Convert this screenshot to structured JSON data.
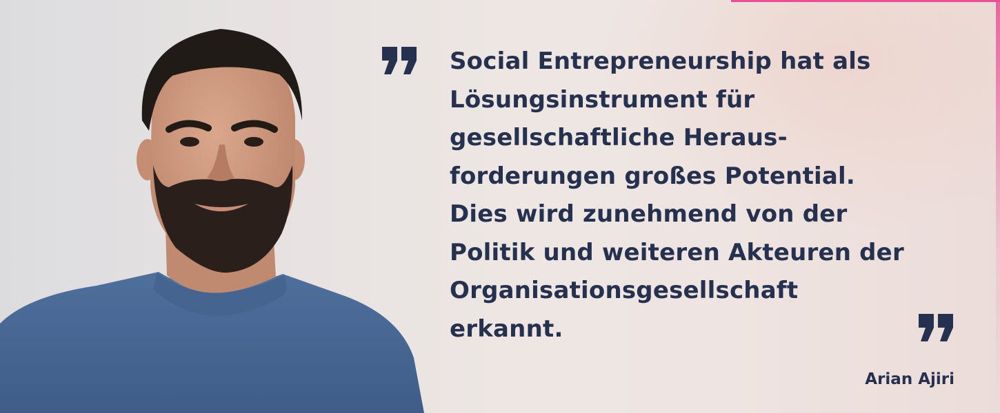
{
  "quote": {
    "lines": [
      "Social Entrepreneurship hat als",
      "Lösungsinstrument für",
      "gesellschaftliche Heraus-",
      "forderungen großes Potential.",
      "Dies wird zunehmend von der",
      "Politik und weiteren Akteuren der",
      "Organisationsgesellschaft",
      "erkannt."
    ],
    "author": "Arian Ajiri"
  },
  "colors": {
    "text": "#26304f",
    "accent": "#e84f96"
  },
  "icons": {
    "open_quote": "quotation-mark-icon",
    "close_quote": "quotation-mark-icon"
  }
}
